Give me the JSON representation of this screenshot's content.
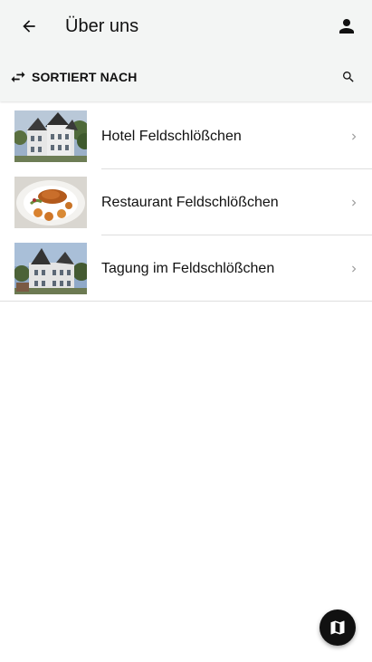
{
  "header": {
    "title": "Über uns",
    "sort_label": "SORTIERT NACH"
  },
  "items": [
    {
      "label": "Hotel Feldschlößchen",
      "thumbnail": "hotel-building-photo"
    },
    {
      "label": "Restaurant Feldschlößchen",
      "thumbnail": "food-plate-photo"
    },
    {
      "label": "Tagung im Feldschlößchen",
      "thumbnail": "hotel-exterior-photo"
    }
  ],
  "icons": {
    "back": "arrow-left-icon",
    "account": "person-icon",
    "sort": "swap-arrows-icon",
    "search": "search-icon",
    "chevron": "chevron-right-icon",
    "map": "map-icon"
  },
  "colors": {
    "header_bg": "#f3f5f4",
    "fab_bg": "#111111",
    "divider": "#dedede",
    "chevron": "#9e9e9e"
  }
}
